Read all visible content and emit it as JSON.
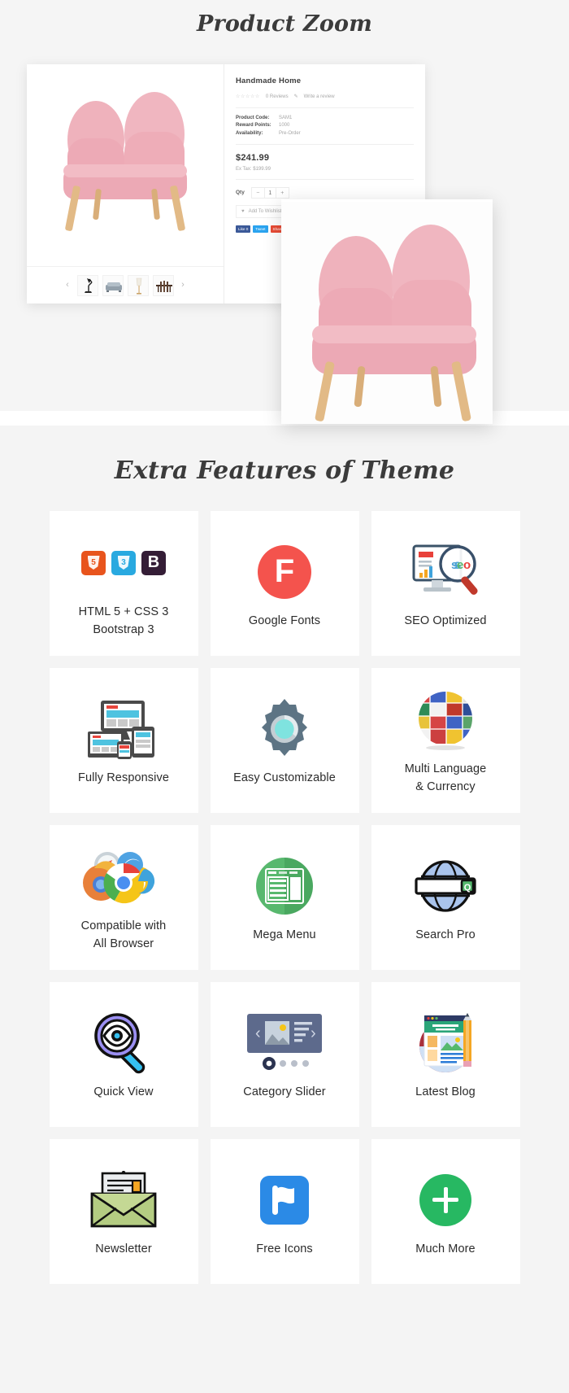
{
  "sections": {
    "zoom": {
      "title": "Product Zoom",
      "product": {
        "name": "Handmade Home",
        "stars": "☆☆☆☆☆",
        "reviews": "0 Reviews",
        "write_review": "Write a review",
        "pencil_icon": "✎",
        "meta": [
          {
            "key": "Product Code:",
            "value": "SAM1"
          },
          {
            "key": "Reward Points:",
            "value": "1000"
          },
          {
            "key": "Availability:",
            "value": "Pre-Order"
          }
        ],
        "price": "$241.99",
        "ex_tax": "Ex Tax: $199.99",
        "qty_label": "Qty",
        "qty_minus": "−",
        "qty_value": "1",
        "qty_plus": "+",
        "wishlist_label": "Add To Wishlist",
        "heart_icon": "♥",
        "compare_icon": "⇄",
        "social": [
          {
            "label": "Like 0",
            "color": "#3b5998"
          },
          {
            "label": "Tweet",
            "color": "#2aa3ef"
          },
          {
            "label": "Share",
            "color": "#e94b35"
          }
        ],
        "thumb_prev": "‹",
        "thumb_next": "›",
        "thumbs": [
          "desk-lamp",
          "sofa",
          "floor-lamp",
          "dining-set"
        ]
      }
    },
    "features": {
      "title": "Extra Features of Theme",
      "items": [
        {
          "label": "HTML 5 + CSS 3\nBootstrap 3",
          "icon": "html5-css3-bootstrap-icon",
          "html5_text": "5",
          "css3_text": "3",
          "bootstrap_text": "B",
          "html5_color": "#e8541d",
          "css3_color": "#29a9e0",
          "bootstrap_color": "#341d36"
        },
        {
          "label": "Google Fonts",
          "icon": "google-fonts-icon",
          "glyph": "F",
          "color": "#f4534d"
        },
        {
          "label": "SEO Optimized",
          "icon": "seo-optimized-icon",
          "glyph": "seo"
        },
        {
          "label": "Fully Responsive",
          "icon": "responsive-devices-icon"
        },
        {
          "label": "Easy Customizable",
          "icon": "gear-icon",
          "color": "#5d7484"
        },
        {
          "label": "Multi Language\n& Currency",
          "icon": "flags-globe-icon"
        },
        {
          "label": "Compatible with\nAll Browser",
          "icon": "browsers-icon"
        },
        {
          "label": "Mega Menu",
          "icon": "mega-menu-icon",
          "color": "#58b86e"
        },
        {
          "label": "Search Pro",
          "icon": "search-globe-icon",
          "glyph": "Q"
        },
        {
          "label": "Quick View",
          "icon": "quick-view-magnifier-eye-icon",
          "color": "#8b7ff0"
        },
        {
          "label": "Category Slider",
          "icon": "category-slider-icon",
          "prev": "‹",
          "next": "›"
        },
        {
          "label": "Latest Blog",
          "icon": "latest-blog-icon",
          "color": "#a92f3b"
        },
        {
          "label": "Newsletter",
          "icon": "newsletter-envelope-icon",
          "color": "#b4cc82"
        },
        {
          "label": "Free Icons",
          "icon": "flag-icon",
          "color": "#2b8ae6"
        },
        {
          "label": "Much More",
          "icon": "plus-circle-icon",
          "color": "#27b862"
        }
      ]
    }
  }
}
